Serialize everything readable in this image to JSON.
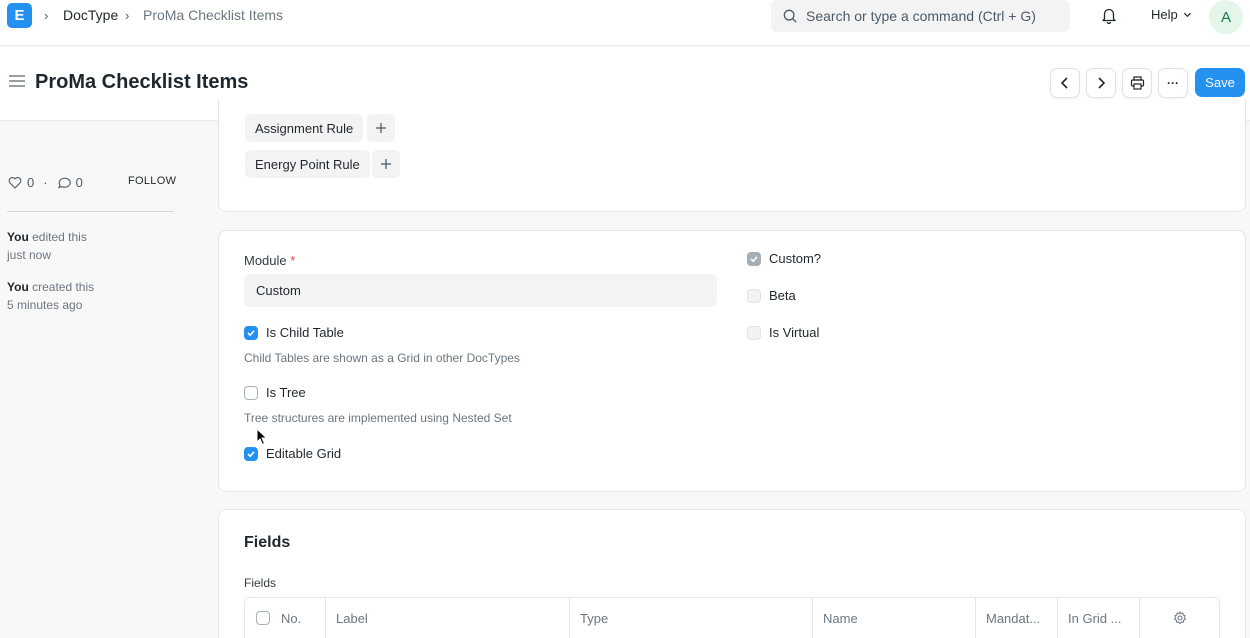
{
  "navbar": {
    "logo_letter": "E",
    "breadcrumbs": [
      "DocType",
      "ProMa Checklist Items"
    ],
    "search_placeholder": "Search or type a command (Ctrl + G)",
    "help_label": "Help",
    "avatar_initial": "A"
  },
  "page": {
    "title": "ProMa Checklist Items",
    "save_label": "Save",
    "more_label": "···"
  },
  "sidebar": {
    "likes": "0",
    "comments": "0",
    "dot": "·",
    "follow_label": "FOLLOW",
    "activity": [
      {
        "actor": "You",
        "action": " edited this",
        "time": "just now"
      },
      {
        "actor": "You",
        "action": " created this",
        "time": "5 minutes ago"
      }
    ]
  },
  "connections": {
    "items": [
      "Assignment Rule",
      "Energy Point Rule"
    ]
  },
  "settings": {
    "module_label": "Module",
    "module_required": "*",
    "module_value": "Custom",
    "is_child_table": {
      "label": "Is Child Table",
      "checked": true,
      "description": "Child Tables are shown as a Grid in other DocTypes"
    },
    "is_tree": {
      "label": "Is Tree",
      "checked": false,
      "description": "Tree structures are implemented using Nested Set"
    },
    "editable_grid": {
      "label": "Editable Grid",
      "checked": true
    },
    "custom": {
      "label": "Custom?",
      "checked": true
    },
    "beta": {
      "label": "Beta",
      "checked": false
    },
    "is_virtual": {
      "label": "Is Virtual",
      "checked": false
    }
  },
  "fields_section": {
    "title": "Fields",
    "grid_label": "Fields",
    "columns": [
      "No.",
      "Label",
      "Type",
      "Name",
      "Mandat...",
      "In Grid ..."
    ]
  },
  "colors": {
    "primary": "#2490ef",
    "required": "#e24c4c",
    "avatar_bg": "#e4f5e9",
    "avatar_fg": "#16794c"
  }
}
